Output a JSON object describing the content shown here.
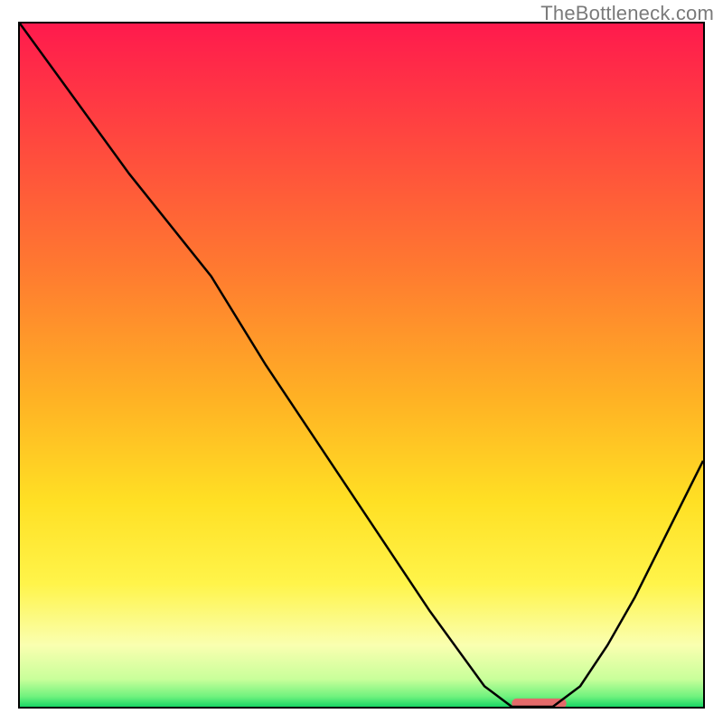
{
  "watermark": "TheBottleneck.com",
  "chart_data": {
    "type": "line",
    "title": "",
    "xlabel": "",
    "ylabel": "",
    "xlim": [
      0,
      100
    ],
    "ylim": [
      0,
      100
    ],
    "series": [
      {
        "name": "curve",
        "x": [
          0,
          8,
          16,
          24,
          28,
          36,
          44,
          52,
          60,
          68,
          72,
          75,
          78,
          82,
          86,
          90,
          94,
          100
        ],
        "y": [
          100,
          89,
          78,
          68,
          63,
          50,
          38,
          26,
          14,
          3,
          0,
          0,
          0,
          3,
          9,
          16,
          24,
          36
        ]
      }
    ],
    "marker": {
      "name": "optimal-range",
      "x_start": 72,
      "x_end": 80,
      "y": 0,
      "color": "#e46a6a"
    },
    "gradient": {
      "stops": [
        {
          "offset": 0.0,
          "color": "#ff1a4d"
        },
        {
          "offset": 0.18,
          "color": "#ff4a3e"
        },
        {
          "offset": 0.36,
          "color": "#ff7a30"
        },
        {
          "offset": 0.55,
          "color": "#ffb224"
        },
        {
          "offset": 0.7,
          "color": "#ffe024"
        },
        {
          "offset": 0.82,
          "color": "#fff44a"
        },
        {
          "offset": 0.91,
          "color": "#faffb0"
        },
        {
          "offset": 0.96,
          "color": "#c8ff9a"
        },
        {
          "offset": 0.985,
          "color": "#70f27e"
        },
        {
          "offset": 1.0,
          "color": "#18d665"
        }
      ]
    }
  }
}
